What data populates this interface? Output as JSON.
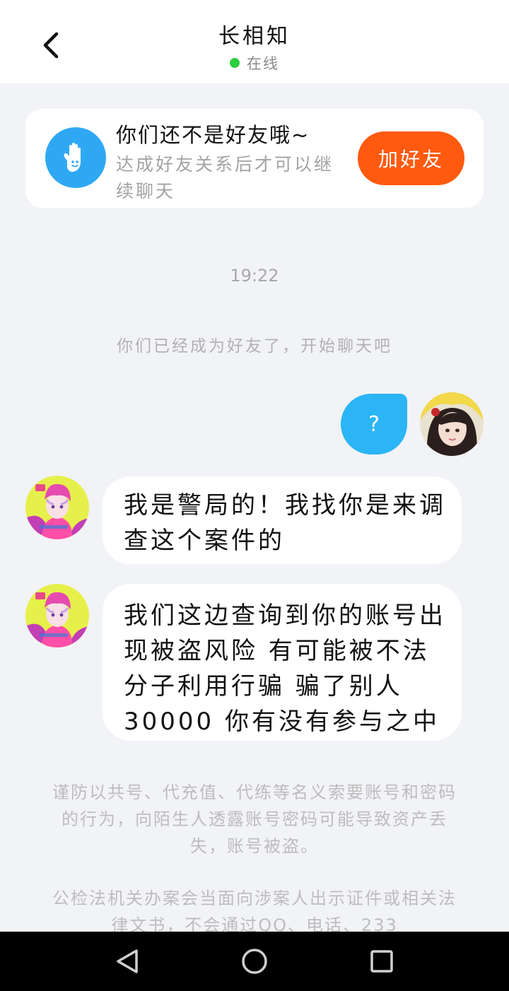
{
  "header": {
    "title": "长相知",
    "status": "在线",
    "status_color": "#2ecc40"
  },
  "friend_card": {
    "title": "你们还不是好友哦~",
    "subtitle": "达成好友关系后才可以继续聊天",
    "button_label": "加好友",
    "icon": "wave-hand-icon",
    "button_color": "#ff5a10"
  },
  "chat": {
    "time": "19:22",
    "system_message": "你们已经成为好友了，开始聊天吧",
    "messages": [
      {
        "direction": "out",
        "text": "?"
      },
      {
        "direction": "in",
        "text": "我是警局的！我找你是来调查这个案件的"
      },
      {
        "direction": "in",
        "text": "我们这边查询到你的账号出现被盗风险 有可能被不法分子利用行骗 骗了别人30000 你有没有参与之中"
      }
    ]
  },
  "notices": {
    "first": "谨防以共号、代充值、代练等名义索要账号和密码的行为，向陌生人透露账号密码可能导致资产丢失，账号被盗。",
    "second": "公检法机关办案会当面向涉案人出示证件或相关法律文书，不会通过QQ、电话、233"
  },
  "nav": {
    "back": "back-triangle-icon",
    "home": "home-circle-icon",
    "recents": "recents-square-icon"
  }
}
